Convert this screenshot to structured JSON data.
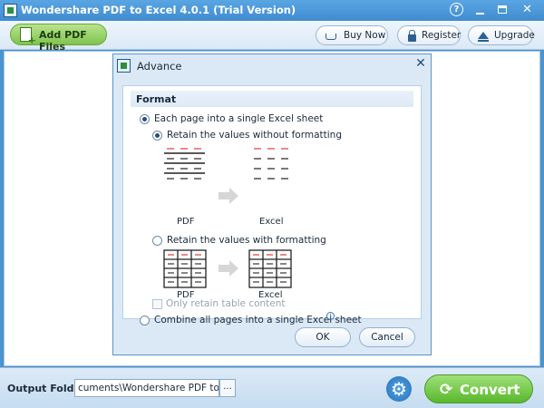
{
  "window": {
    "title": "Wondershare PDF to Excel 4.0.1 (Trial Version)",
    "help_glyph": "?",
    "close_glyph": "✕"
  },
  "toolbar": {
    "add_pdf_label": "Add PDF Files",
    "buy_now_label": "Buy Now",
    "register_label": "Register",
    "upgrade_label": "Upgrade"
  },
  "dialog": {
    "title": "Advance",
    "close_glyph": "✕",
    "format_heading": "Format",
    "options": {
      "each_page": {
        "label": "Each page into a single Excel sheet",
        "selected": true
      },
      "without_formatting": {
        "label": "Retain the values without formatting",
        "selected": true
      },
      "with_formatting": {
        "label": "Retain the values with formatting",
        "selected": false
      },
      "combine_all": {
        "label": "Combine all pages into a single Excel sheet",
        "selected": false
      },
      "only_table": {
        "label": "Only retain table content",
        "checked": false,
        "disabled": true
      }
    },
    "figure_labels": {
      "pdf": "PDF",
      "excel": "Excel"
    },
    "help_glyph": "i",
    "ok_label": "OK",
    "cancel_label": "Cancel"
  },
  "bottom": {
    "output_folder_label": "Output Folder:",
    "output_folder_value": "cuments\\Wondershare PDF to Excel\\",
    "browse_label": "...",
    "settings_glyph": "⚙",
    "convert_label": "Convert",
    "convert_glyph": "⟳"
  },
  "colors": {
    "accent_blue": "#4b94cf",
    "convert_green": "#59b82c",
    "figure_red": "#e03a3a"
  }
}
